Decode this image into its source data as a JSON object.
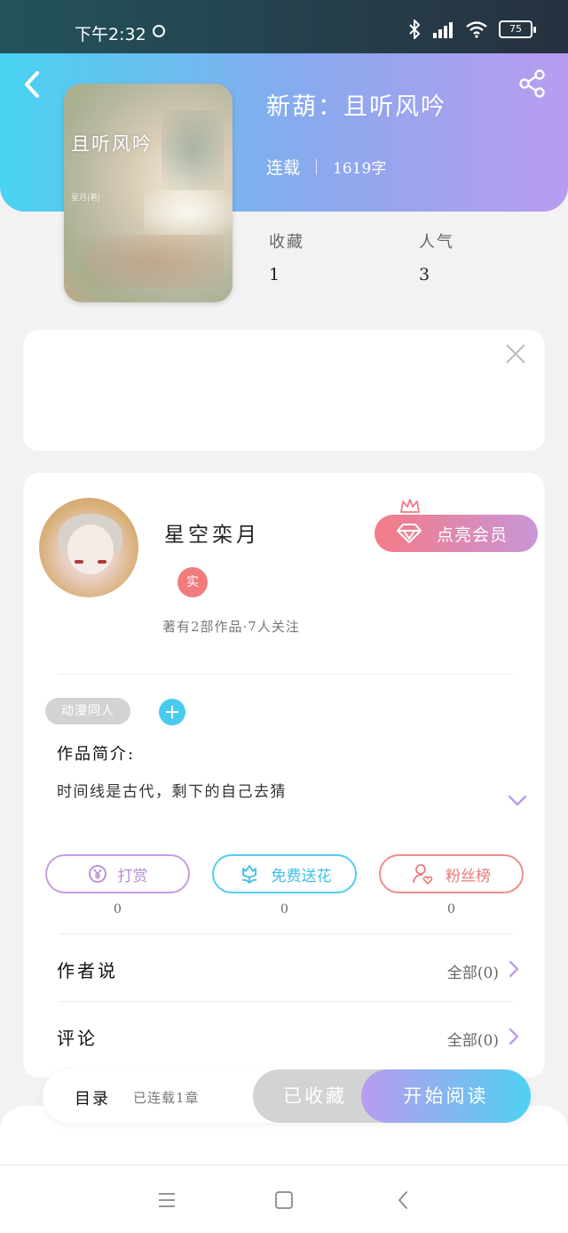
{
  "status_bar": {
    "time": "下午2:32",
    "battery": "75"
  },
  "book": {
    "title": "新葫：且听风吟",
    "status": "连载",
    "word_count": "1619字",
    "cover_title": "且听风吟",
    "cover_author": "星月|著|",
    "stats": [
      {
        "label": "收藏",
        "value": "1"
      },
      {
        "label": "人气",
        "value": "3"
      }
    ]
  },
  "author": {
    "name": "星空栾月",
    "badge": "实",
    "stats": "著有2部作品·7人关注",
    "vip_label": "点亮会员"
  },
  "tags": {
    "items": [
      "动漫同人"
    ]
  },
  "intro": {
    "label": "作品简介:",
    "text": "时间线是古代，剩下的自己去猜"
  },
  "actions": [
    {
      "label": "打赏",
      "count": "0",
      "color": "#b58ad6"
    },
    {
      "label": "免费送花",
      "count": "0",
      "color": "#3dbfe5"
    },
    {
      "label": "粉丝榜",
      "count": "0",
      "color": "#ea7a7a"
    }
  ],
  "rows": [
    {
      "label": "作者说",
      "value": "全部(0)"
    },
    {
      "label": "评论",
      "value": "全部(0)"
    }
  ],
  "bottom_bar": {
    "toc": "目录",
    "toc_sub": "已连载1章",
    "favorited": "已收藏",
    "read": "开始阅读"
  },
  "colors": {
    "accent_blue": "#49d3f2",
    "accent_purple": "#b99cef",
    "vip_pink": "#f47b86"
  }
}
